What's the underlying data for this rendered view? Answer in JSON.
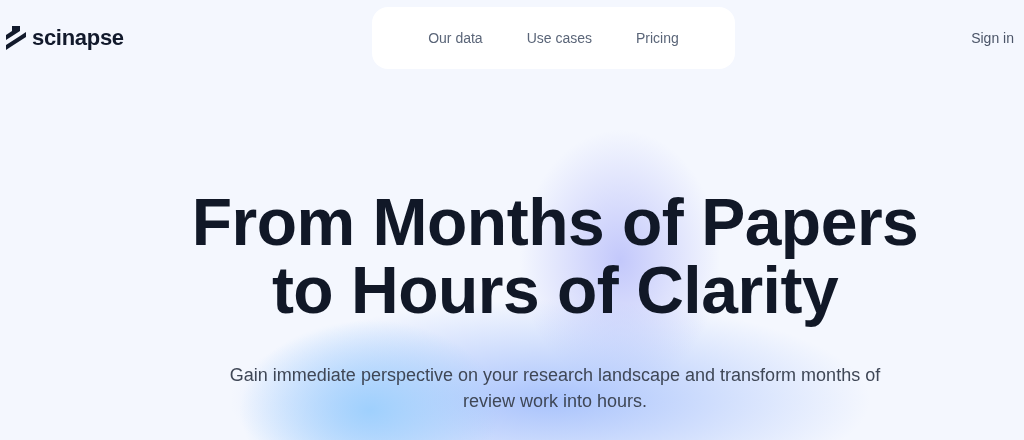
{
  "header": {
    "logo": "scinapse",
    "nav": [
      {
        "label": "Our data"
      },
      {
        "label": "Use cases"
      },
      {
        "label": "Pricing"
      }
    ],
    "sign_in": "Sign in"
  },
  "hero": {
    "title_lines": [
      "From Months of Papers",
      "to Hours of Clarity"
    ],
    "subtitle": "Gain immediate perspective on your research landscape and transform months of review work into hours."
  }
}
